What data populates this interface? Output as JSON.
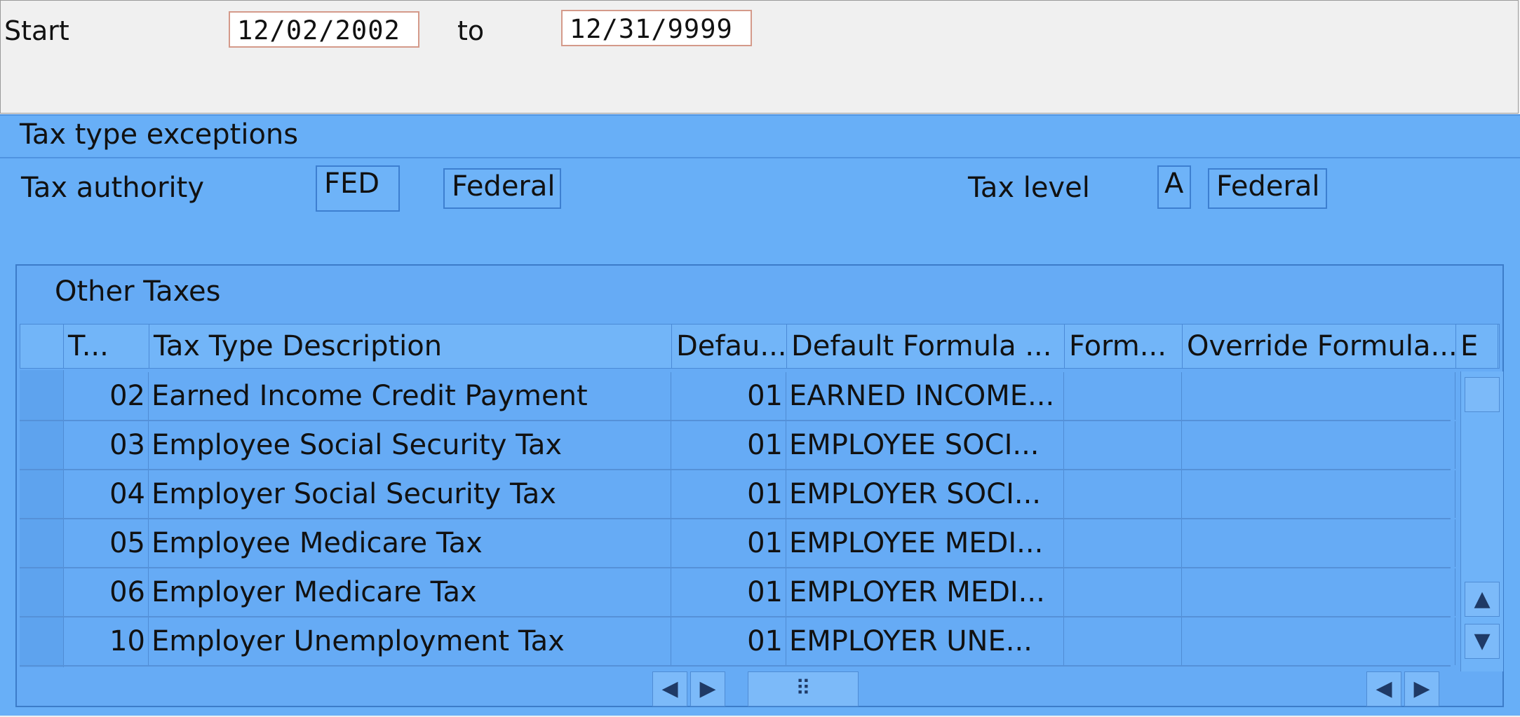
{
  "date_range": {
    "start_label": "Start",
    "start_value": "12/02/2002",
    "to_label": "to",
    "end_value": "12/31/9999"
  },
  "panel": {
    "title": "Tax type exceptions",
    "tax_authority_label": "Tax authority",
    "tax_authority_code": "FED",
    "tax_authority_name": "Federal",
    "tax_level_label": "Tax level",
    "tax_level_code": "A",
    "tax_level_name": "Federal"
  },
  "table": {
    "title": "Other Taxes",
    "columns": [
      "T...",
      "Tax Type Description",
      "Defau...",
      "Default Formula ...",
      "Form...",
      "Override Formula...",
      "E"
    ],
    "rows": [
      {
        "code": "02",
        "description": "Earned Income Credit Payment",
        "default_code": "01",
        "default_formula": "EARNED INCOME..."
      },
      {
        "code": "03",
        "description": "Employee Social Security Tax",
        "default_code": "01",
        "default_formula": "EMPLOYEE SOCI..."
      },
      {
        "code": "04",
        "description": "Employer Social Security Tax",
        "default_code": "01",
        "default_formula": "EMPLOYER SOCI..."
      },
      {
        "code": "05",
        "description": "Employee Medicare Tax",
        "default_code": "01",
        "default_formula": "EMPLOYEE MEDI..."
      },
      {
        "code": "06",
        "description": "Employer Medicare Tax",
        "default_code": "01",
        "default_formula": "EMPLOYER MEDI..."
      },
      {
        "code": "10",
        "description": "Employer Unemployment Tax",
        "default_code": "01",
        "default_formula": "EMPLOYER UNE..."
      }
    ],
    "icons": {
      "scroll_up": "▲",
      "scroll_down": "▼",
      "left": "◀",
      "right": "▶",
      "grip": "⠿"
    }
  }
}
